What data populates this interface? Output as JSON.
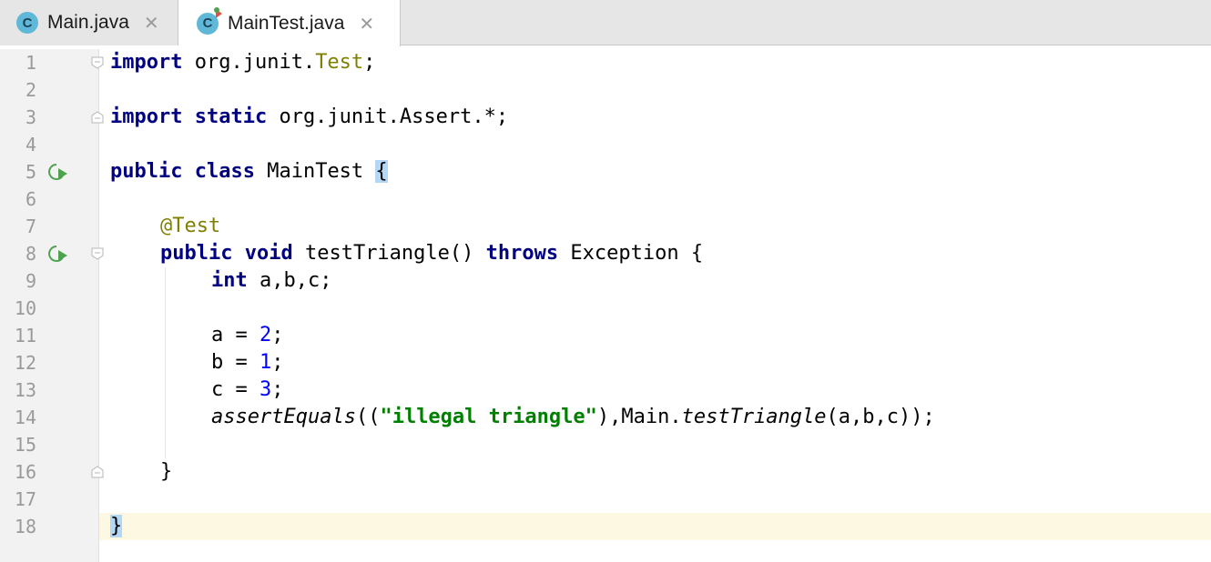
{
  "tabs": [
    {
      "label": "Main.java",
      "icon": "java-class-icon",
      "icon_letter": "C",
      "active": false,
      "close": "✕"
    },
    {
      "label": "MainTest.java",
      "icon": "java-test-class-icon",
      "icon_letter": "C",
      "active": true,
      "close": "✕"
    }
  ],
  "editor": {
    "current_line": 18,
    "line_numbers": [
      "1",
      "2",
      "3",
      "4",
      "5",
      "6",
      "7",
      "8",
      "9",
      "10",
      "11",
      "12",
      "13",
      "14",
      "15",
      "16",
      "17",
      "18"
    ],
    "code": {
      "l1": {
        "kw": "import",
        "pkg": " org.junit.",
        "cls": "Test",
        "end": ";"
      },
      "l3": {
        "kw1": "import",
        "kw2": " static",
        "rest": " org.junit.Assert.*;"
      },
      "l5": {
        "kw1": "public",
        "kw2": " class",
        "name": " MainTest ",
        "brace": "{"
      },
      "l7": {
        "ann": "@Test"
      },
      "l8": {
        "kw1": "public",
        "kw2": " void",
        "name": " testTriangle() ",
        "kw3": "throws",
        "rest": " Exception {"
      },
      "l9": {
        "kw": "int",
        "rest": " a,b,c;"
      },
      "l11": {
        "pre": "a = ",
        "num": "2",
        "end": ";"
      },
      "l12": {
        "pre": "b = ",
        "num": "1",
        "end": ";"
      },
      "l13": {
        "pre": "c = ",
        "num": "3",
        "end": ";"
      },
      "l14": {
        "fn": "assertEquals",
        "p1": "((",
        "str": "\"illegal triangle\"",
        "p2": "),Main.",
        "fn2": "testTriangle",
        "p3": "(a,b,c));"
      },
      "l16": {
        "brace": "}"
      },
      "l18": {
        "brace": "}"
      }
    }
  },
  "colors": {
    "keyword": "#000080",
    "annotation": "#808000",
    "number": "#0000ff",
    "string": "#008000",
    "current_line": "#fdf8e1",
    "brace_match": "#b3d7f5"
  }
}
